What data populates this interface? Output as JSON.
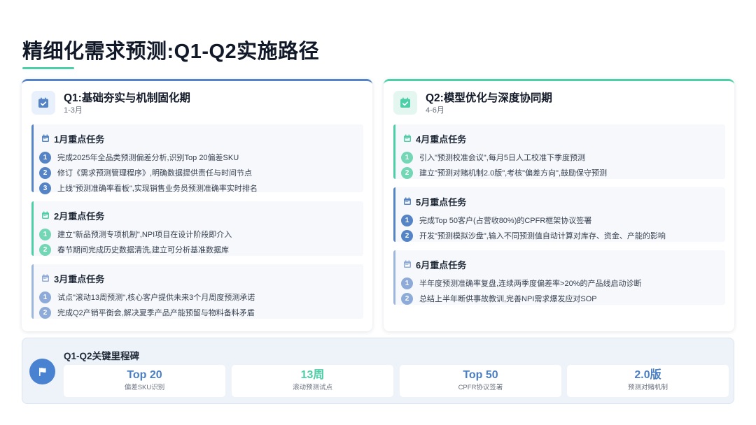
{
  "title": "精细化需求预测:Q1-Q2实施路径",
  "q1": {
    "title": "Q1:基础夯实与机制固化期",
    "subtitle": "1-3月",
    "months": [
      {
        "title": "1月重点任务",
        "tasks": [
          {
            "num": "1",
            "text": "完成2025年全品类预测偏差分析,识别Top 20偏差SKU"
          },
          {
            "num": "2",
            "text": "修订《需求预测管理程序》,明确数据提供责任与时间节点"
          },
          {
            "num": "3",
            "text": "上线\"预测准确率看板\",实现销售业务员预测准确率实时排名"
          }
        ]
      },
      {
        "title": "2月重点任务",
        "tasks": [
          {
            "num": "1",
            "text": "建立\"新品预测专项机制\",NPI项目在设计阶段即介入"
          },
          {
            "num": "2",
            "text": "春节期间完成历史数据清洗,建立可分析基准数据库"
          }
        ]
      },
      {
        "title": "3月重点任务",
        "tasks": [
          {
            "num": "1",
            "text": "试点\"滚动13周预测\",核心客户提供未来3个月周度预测承诺"
          },
          {
            "num": "2",
            "text": "完成Q2产销平衡会,解决夏季产品产能预留与物料备料矛盾"
          }
        ]
      }
    ]
  },
  "q2": {
    "title": "Q2:模型优化与深度协同期",
    "subtitle": "4-6月",
    "months": [
      {
        "title": "4月重点任务",
        "tasks": [
          {
            "num": "1",
            "text": "引入\"预测校准会议\",每月5日人工校准下季度预测"
          },
          {
            "num": "2",
            "text": "建立\"预测对赌机制2.0版\",考核\"偏差方向\",鼓励保守预测"
          }
        ]
      },
      {
        "title": "5月重点任务",
        "tasks": [
          {
            "num": "1",
            "text": "完成Top 50客户(占营收80%)的CPFR框架协议签署"
          },
          {
            "num": "2",
            "text": "开发\"预测模拟沙盘\",输入不同预测值自动计算对库存、资金、产能的影响"
          }
        ]
      },
      {
        "title": "6月重点任务",
        "tasks": [
          {
            "num": "1",
            "text": "半年度预测准确率复盘,连续两季度偏差率>20%的产品线启动诊断"
          },
          {
            "num": "2",
            "text": "总结上半年断供事故教训,完善NPI需求爆发应对SOP"
          }
        ]
      }
    ]
  },
  "milestones": {
    "title": "Q1-Q2关键里程碑",
    "items": [
      {
        "value": "Top 20",
        "label": "偏差SKU识别"
      },
      {
        "value": "13周",
        "label": "滚动预测试点"
      },
      {
        "value": "Top 50",
        "label": "CPFR协议签署"
      },
      {
        "value": "2.0版",
        "label": "预测对赌机制"
      }
    ]
  },
  "colors": {
    "accent_blue": "#5584c6",
    "accent_green": "#4ccfa6",
    "flag_blue": "#4a82d2"
  },
  "icons": [
    "calendar-check-icon",
    "calendar-icon",
    "flag-icon"
  ]
}
